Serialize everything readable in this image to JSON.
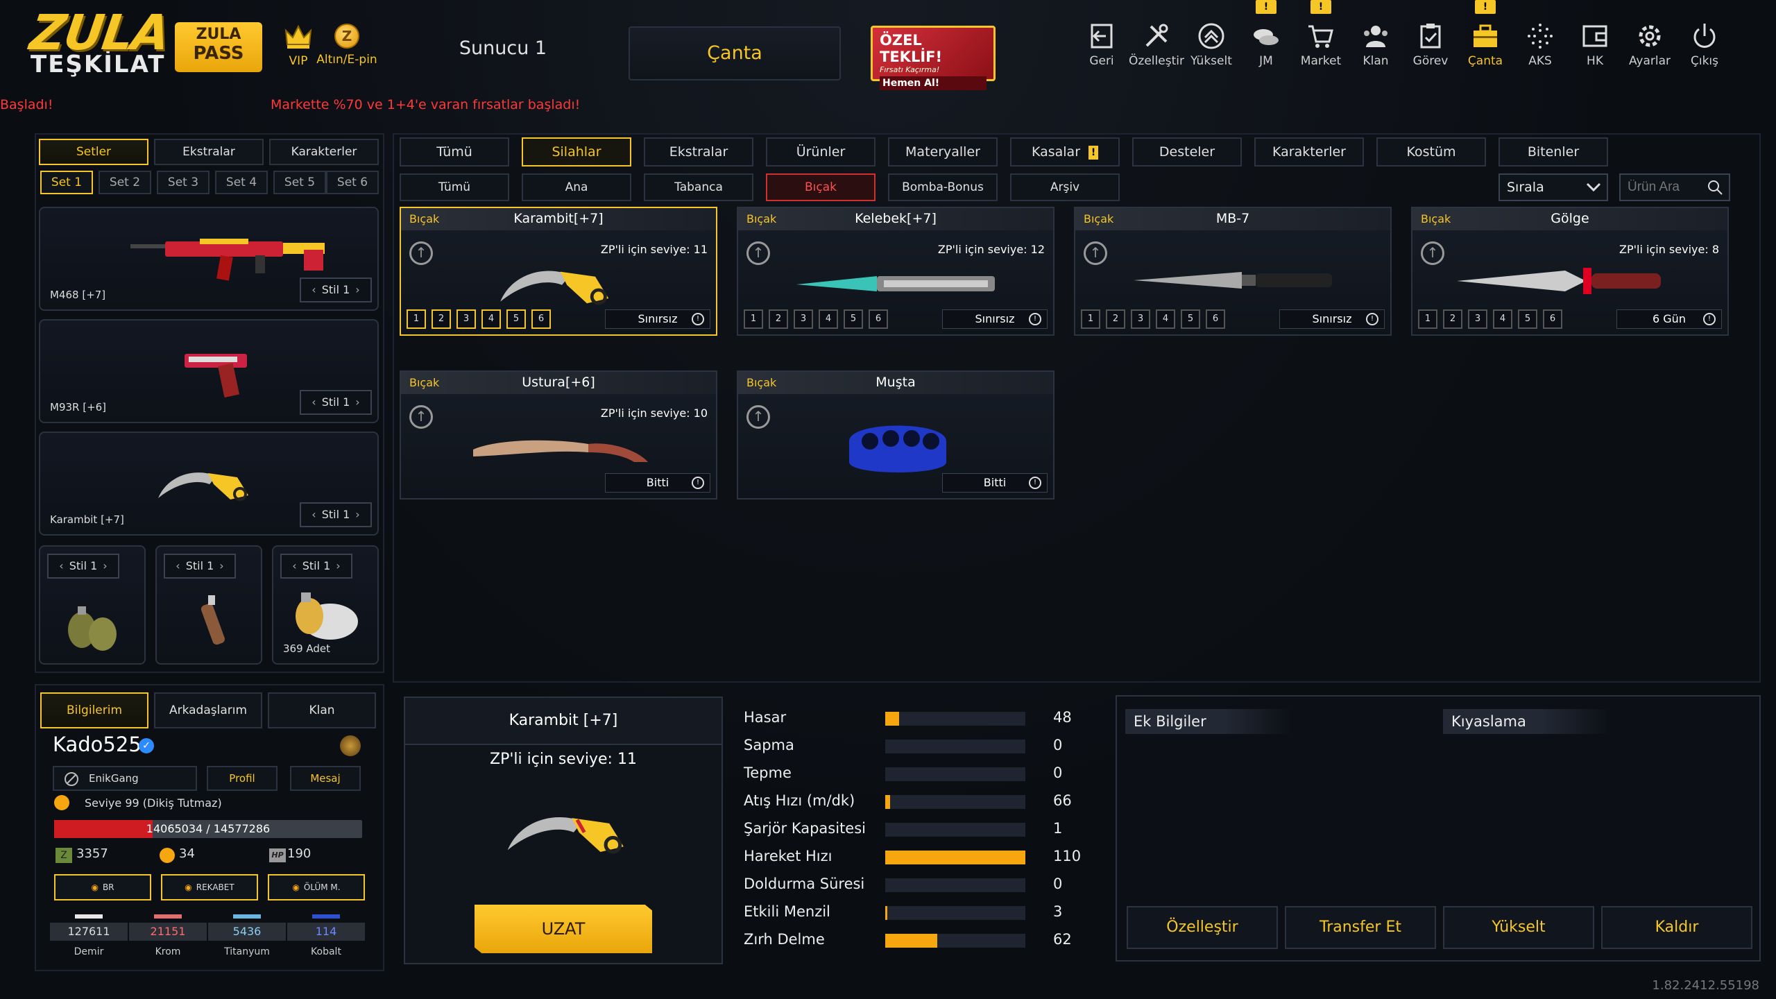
{
  "logo": {
    "top": "ZULA",
    "bottom": "TEŞKİLAT"
  },
  "pass": {
    "line1": "ZULA",
    "line2": "PASS"
  },
  "vip_label": "VIP",
  "altin_label": "Altın/E-pin",
  "server": "Sunucu 1",
  "page_title": "Çanta",
  "offer": {
    "title": "ÖZEL TEKLİF!",
    "subtitle": "Fırsatı Kaçırma!",
    "cta": "Hemen Al!"
  },
  "nav": [
    {
      "label": "Geri",
      "icon": "back-icon",
      "badge": ""
    },
    {
      "label": "Özelleştir",
      "icon": "tools-icon",
      "badge": ""
    },
    {
      "label": "Yükselt",
      "icon": "upgrade-icon",
      "badge": ""
    },
    {
      "label": "JM",
      "icon": "jm-icon",
      "badge": "!"
    },
    {
      "label": "Market",
      "icon": "cart-icon",
      "badge": "!"
    },
    {
      "label": "Klan",
      "icon": "clan-icon",
      "badge": ""
    },
    {
      "label": "Görev",
      "icon": "task-icon",
      "badge": ""
    },
    {
      "label": "Çanta",
      "icon": "bag-icon",
      "badge": "!"
    },
    {
      "label": "AKS",
      "icon": "aks-icon",
      "badge": ""
    },
    {
      "label": "HK",
      "icon": "wallet-icon",
      "badge": ""
    },
    {
      "label": "Ayarlar",
      "icon": "gear-icon",
      "badge": ""
    },
    {
      "label": "Çıkış",
      "icon": "power-icon",
      "badge": ""
    }
  ],
  "ticker": {
    "left": "Başladı!",
    "right": "Markette %70 ve 1+4'e varan fırsatlar başladı!"
  },
  "left": {
    "tabs": [
      "Setler",
      "Ekstralar",
      "Karakterler"
    ],
    "sets": [
      "Set 1",
      "Set 2",
      "Set 3",
      "Set 4",
      "Set 5",
      "Set 6"
    ],
    "slots": [
      {
        "name": "M468 [+7]",
        "stil": "Stil 1"
      },
      {
        "name": "M93R [+6]",
        "stil": "Stil 1"
      },
      {
        "name": "Karambit [+7]",
        "stil": "Stil 1"
      }
    ],
    "small": [
      {
        "stil": "Stil 1",
        "label": ""
      },
      {
        "stil": "Stil 1",
        "label": ""
      },
      {
        "stil": "Stil 1",
        "label": "369 Adet"
      }
    ]
  },
  "profile": {
    "tabs": [
      "Bilgilerim",
      "Arkadaşlarım",
      "Klan"
    ],
    "username": "Kado525",
    "clan": "EnikGang",
    "profil": "Profil",
    "mesaj": "Mesaj",
    "level": "Seviye 99 (Dikiş Tutmaz)",
    "xp": "14065034 / 14577286",
    "xp_fraction": 0.32,
    "zp": "3357",
    "gold": "34",
    "hp": "190",
    "hp_icon": "HP",
    "ranks": [
      "BR",
      "REKABET",
      "ÖLÜM M."
    ],
    "mats": [
      {
        "val": "127611",
        "label": "Demir",
        "color": "#e8e8e8"
      },
      {
        "val": "21151",
        "label": "Krom",
        "color": "#e07070"
      },
      {
        "val": "5436",
        "label": "Titanyum",
        "color": "#6ab6e0"
      },
      {
        "val": "114",
        "label": "Kobalt",
        "color": "#3050d0"
      }
    ]
  },
  "main": {
    "tabs": [
      "Tümü",
      "Silahlar",
      "Ekstralar",
      "Ürünler",
      "Materyaller",
      "Kasalar",
      "Desteler",
      "Karakterler",
      "Kostüm",
      "Bitenler"
    ],
    "kasalar_badge": "!",
    "subtabs": [
      "Tümü",
      "Ana",
      "Tabanca",
      "Bıçak",
      "Bomba-Bonus",
      "Arşiv"
    ],
    "sort": "Sırala",
    "search_placeholder": "Ürün Ara",
    "level_nums": [
      "1",
      "2",
      "3",
      "4",
      "5",
      "6"
    ],
    "cards": [
      {
        "cat": "Bıçak",
        "name": "Karambit[+7]",
        "req": "ZP'li için seviye: 11",
        "dur": "Sınırsız"
      },
      {
        "cat": "Bıçak",
        "name": "Kelebek[+7]",
        "req": "ZP'li için seviye: 12",
        "dur": "Sınırsız"
      },
      {
        "cat": "Bıçak",
        "name": "MB-7",
        "req": "",
        "dur": "Sınırsız"
      },
      {
        "cat": "Bıçak",
        "name": "Gölge",
        "req": "ZP'li için seviye: 8",
        "dur": "6 Gün"
      },
      {
        "cat": "Bıçak",
        "name": "Ustura[+6]",
        "req": "ZP'li için seviye: 10",
        "dur": "Bitti"
      },
      {
        "cat": "Bıçak",
        "name": "Muşta",
        "req": "",
        "dur": "Bitti"
      }
    ]
  },
  "detail": {
    "name": "Karambit [+7]",
    "req": "ZP'li için seviye: 11",
    "button": "UZAT"
  },
  "stats": [
    {
      "label": "Hasar",
      "value": "48",
      "frac": 0.1
    },
    {
      "label": "Sapma",
      "value": "0",
      "frac": 0
    },
    {
      "label": "Tepme",
      "value": "0",
      "frac": 0
    },
    {
      "label": "Atış Hızı (m/dk)",
      "value": "66",
      "frac": 0.035
    },
    {
      "label": "Şarjör Kapasitesi",
      "value": "1",
      "frac": 0
    },
    {
      "label": "Hareket Hızı",
      "value": "110",
      "frac": 1
    },
    {
      "label": "Doldurma Süresi",
      "value": "0",
      "frac": 0
    },
    {
      "label": "Etkili Menzil",
      "value": "3",
      "frac": 0.015
    },
    {
      "label": "Zırh Delme",
      "value": "62",
      "frac": 0.37
    }
  ],
  "extra": {
    "left": "Ek Bilgiler",
    "right": "Kıyaslama"
  },
  "actions": [
    "Özelleştir",
    "Transfer Et",
    "Yükselt",
    "Kaldır"
  ],
  "version": "1.82.2412.55198"
}
